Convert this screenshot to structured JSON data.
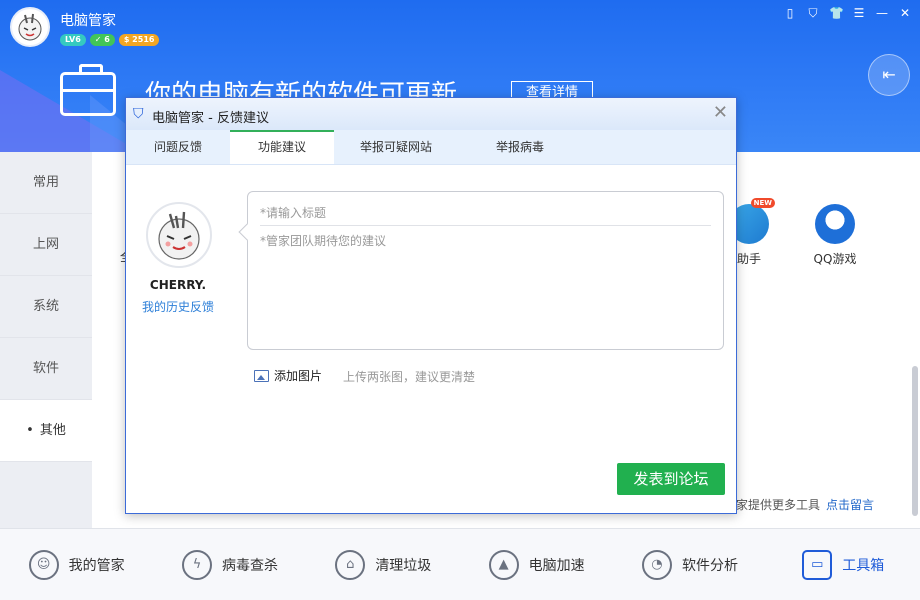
{
  "header": {
    "app_title": "电脑管家",
    "badges": {
      "level": "LV6",
      "check": "✓ 6",
      "coins": "$ 2516"
    },
    "headline": "你的电脑有新的软件可更新",
    "detail_button": "查看详情",
    "window_controls": [
      "phone-icon",
      "shield-icon",
      "skin-icon",
      "menu-icon",
      "minimize-icon",
      "close-icon"
    ]
  },
  "sidebar": {
    "items": [
      {
        "label": "常用"
      },
      {
        "label": "上网"
      },
      {
        "label": "系统"
      },
      {
        "label": "软件"
      },
      {
        "label": "其他",
        "active": true
      }
    ]
  },
  "content": {
    "peek_char": "全",
    "tools": [
      {
        "label": "助手",
        "badge": "NEW"
      },
      {
        "label": "QQ游戏"
      }
    ],
    "footer_text": "家提供更多工具",
    "footer_link": "点击留言"
  },
  "bottombar": {
    "items": [
      {
        "label": "我的管家",
        "icon": "person-icon"
      },
      {
        "label": "病毒查杀",
        "icon": "lightning-icon"
      },
      {
        "label": "清理垃圾",
        "icon": "broom-icon"
      },
      {
        "label": "电脑加速",
        "icon": "rocket-icon"
      },
      {
        "label": "软件分析",
        "icon": "magnifier-icon"
      },
      {
        "label": "工具箱",
        "icon": "toolbox-icon",
        "active": true
      }
    ]
  },
  "modal": {
    "title": "电脑管家 - 反馈建议",
    "tabs": [
      {
        "label": "问题反馈"
      },
      {
        "label": "功能建议",
        "active": true
      },
      {
        "label": "举报可疑网站"
      },
      {
        "label": "举报病毒"
      }
    ],
    "user": {
      "name": "CHERRY.",
      "history_link": "我的历史反馈"
    },
    "title_placeholder": "*请输入标题",
    "body_placeholder": "*管家团队期待您的建议",
    "add_image": "添加图片",
    "add_image_hint": "上传两张图，建议更清楚",
    "submit": "发表到论坛"
  },
  "colors": {
    "header_blue": "#2e7af5",
    "submit_green": "#21b04f",
    "tab_active_border": "#33b05a",
    "link_blue": "#2d7fd8"
  }
}
